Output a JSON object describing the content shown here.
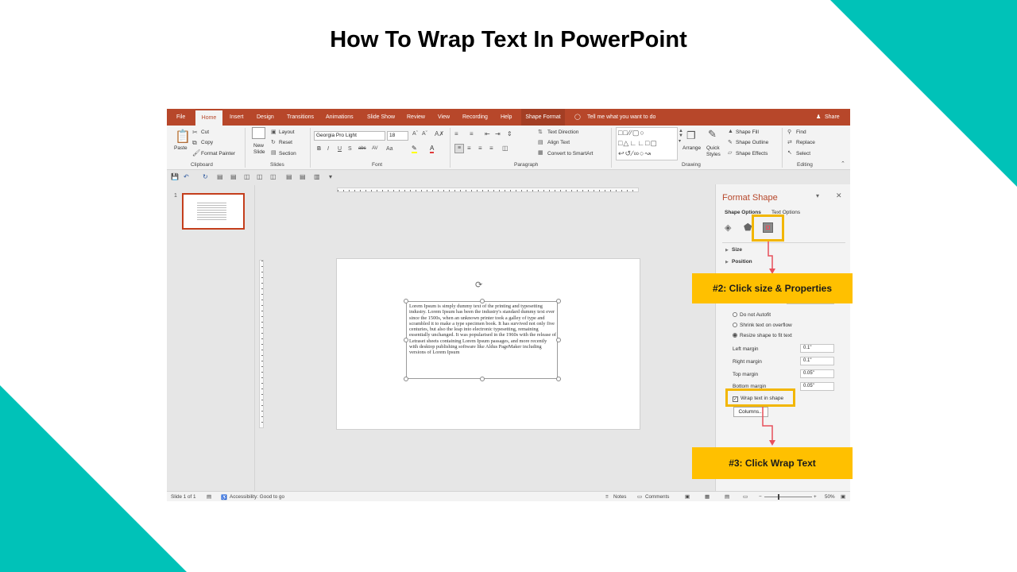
{
  "slide": {
    "title": "How To Wrap Text In PowerPoint",
    "accent_color": "#00c2b8",
    "highlight_color": "#ffc000",
    "arrow_color": "#e8505b"
  },
  "app": {
    "tabs": [
      "File",
      "Home",
      "Insert",
      "Design",
      "Transitions",
      "Animations",
      "Slide Show",
      "Review",
      "View",
      "Recording",
      "Help",
      "Shape Format"
    ],
    "active_tab": "Home",
    "tell_me": "Tell me what you want to do",
    "share": "Share",
    "ribbon": {
      "clipboard": {
        "paste": "Paste",
        "cut": "Cut",
        "copy": "Copy",
        "format_painter": "Format Painter",
        "group": "Clipboard"
      },
      "slides": {
        "new_slide": "New Slide",
        "layout": "Layout",
        "reset": "Reset",
        "section": "Section",
        "group": "Slides"
      },
      "font": {
        "family": "Georgia Pro Light",
        "size": "18",
        "group": "Font"
      },
      "paragraph": {
        "text_direction": "Text Direction",
        "align_text": "Align Text",
        "smartart": "Convert to SmartArt",
        "group": "Paragraph"
      },
      "drawing": {
        "arrange": "Arrange",
        "quick_styles": "Quick Styles",
        "shape_fill": "Shape Fill",
        "shape_outline": "Shape Outline",
        "shape_effects": "Shape Effects",
        "group": "Drawing"
      },
      "editing": {
        "find": "Find",
        "replace": "Replace",
        "select": "Select",
        "group": "Editing"
      }
    },
    "thumbnail_number": "1",
    "lorem_text": "Lorem Ipsum is simply dummy text of the printing and typesetting industry. Lorem Ipsum has been the industry's standard dummy text ever since the 1500s, when an unknown printer took a galley of type and scrambled it to make a type specimen book. It has survived not only five centuries, but also the leap into electronic typesetting, remaining essentially unchanged. It was popularised in the 1960s with the release of Letraset sheets containing Lorem Ipsum passages, and more recently with desktop publishing software like Aldus PageMaker including versions of Lorem Ipsum",
    "format_pane": {
      "title": "Format Shape",
      "shape_options": "Shape Options",
      "text_options": "Text Options",
      "size": "Size",
      "position": "Position",
      "do_not_autofit": "Do not Autofit",
      "shrink_text": "Shrink text on overflow",
      "resize_shape": "Resize shape to fit text",
      "left_margin": "Left margin",
      "left_margin_value": "0.1\"",
      "right_margin": "Right margin",
      "right_margin_value": "0.1\"",
      "top_margin": "Top margin",
      "top_margin_value": "0.05\"",
      "bottom_margin": "Bottom margin",
      "bottom_margin_value": "0.05\"",
      "wrap_text": "Wrap text in shape",
      "columns": "Columns..."
    },
    "status": {
      "slide_count": "Slide 1 of 1",
      "accessibility": "Accessibility: Good to go",
      "notes": "Notes",
      "comments": "Comments",
      "zoom": "50%"
    }
  },
  "callouts": {
    "step2": "#2: Click size & Properties",
    "step3": "#3: Click Wrap Text"
  }
}
